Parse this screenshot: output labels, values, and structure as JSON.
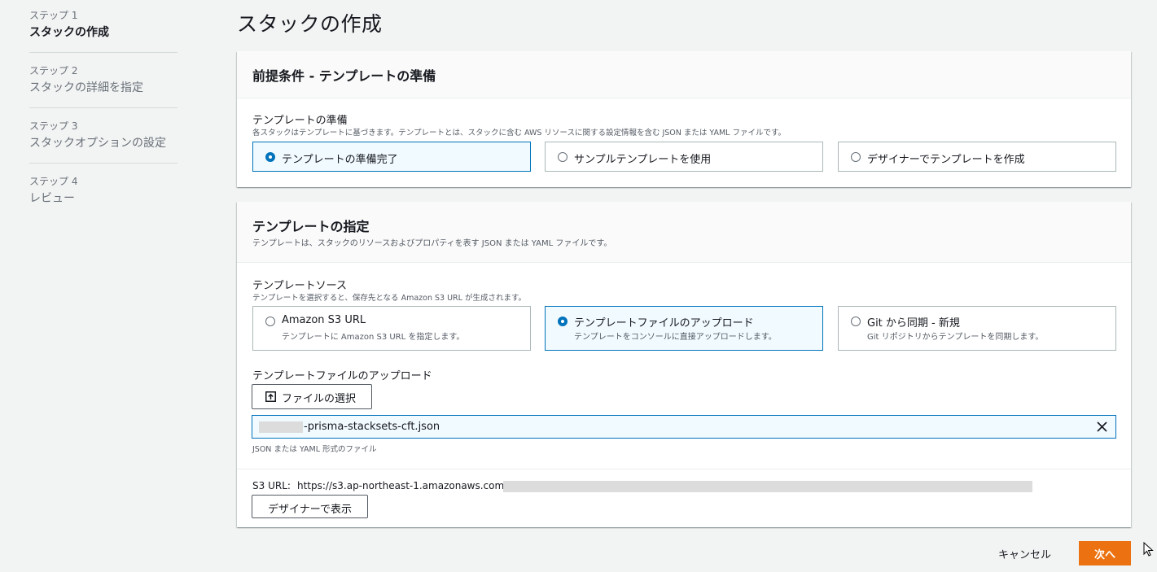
{
  "nav": {
    "steps": [
      {
        "num": "ステップ 1",
        "name": "スタックの作成"
      },
      {
        "num": "ステップ 2",
        "name": "スタックの詳細を指定"
      },
      {
        "num": "ステップ 3",
        "name": "スタックオプションの設定"
      },
      {
        "num": "ステップ 4",
        "name": "レビュー"
      }
    ],
    "active_step": 1
  },
  "page": {
    "title": "スタックの作成"
  },
  "prereq": {
    "title": "前提条件 - テンプレートの準備",
    "field_label": "テンプレートの準備",
    "field_desc": "各スタックはテンプレートに基づきます。テンプレートとは、スタックに含む AWS リソースに関する設定情報を含む JSON または YAML ファイルです。",
    "options": [
      {
        "label": "テンプレートの準備完了",
        "selected": true
      },
      {
        "label": "サンプルテンプレートを使用",
        "selected": false
      },
      {
        "label": "デザイナーでテンプレートを作成",
        "selected": false
      }
    ]
  },
  "spec": {
    "title": "テンプレートの指定",
    "desc": "テンプレートは、スタックのリソースおよびプロパティを表す JSON または YAML ファイルです。",
    "source_label": "テンプレートソース",
    "source_desc": "テンプレートを選択すると、保存先となる Amazon S3 URL が生成されます。",
    "options": [
      {
        "label": "Amazon S3 URL",
        "desc": "テンプレートに Amazon S3 URL を指定します。",
        "selected": false
      },
      {
        "label": "テンプレートファイルのアップロード",
        "desc": "テンプレートをコンソールに直接アップロードします。",
        "selected": true
      },
      {
        "label": "Git から同期 - 新規",
        "desc": "Git リポジトリからテンプレートを同期します。",
        "selected": false
      }
    ],
    "upload_label": "テンプレートファイルのアップロード",
    "choose_file_label": "ファイルの選択",
    "file_name": "-prisma-stacksets-cft.json",
    "file_hint": "JSON または YAML 形式のファイル",
    "s3_url_label": "S3 URL:",
    "s3_url_value": "https://s3.ap-northeast-1.amazonaws.com/",
    "view_designer_label": "デザイナーで表示"
  },
  "footer": {
    "cancel_label": "キャンセル",
    "next_label": "次へ"
  },
  "colors": {
    "primary": "#ec7211",
    "selected_border": "#0073bb",
    "selected_bg": "#f1faff"
  }
}
